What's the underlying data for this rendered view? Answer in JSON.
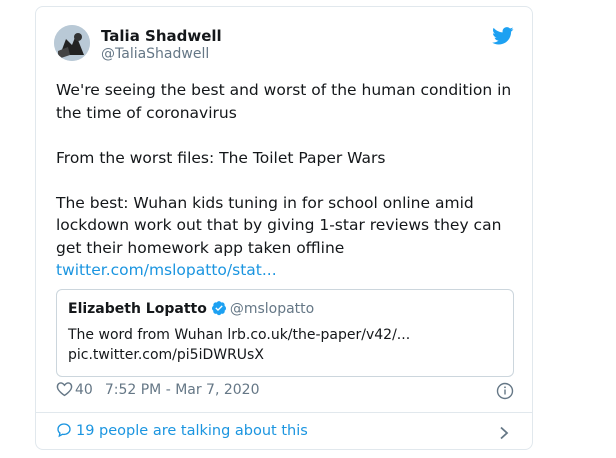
{
  "author": {
    "name": "Talia Shadwell",
    "handle": "@TaliaShadwell"
  },
  "tweet": {
    "paragraphs": [
      "We're seeing the best and worst of the human condition in the time of coronavirus",
      "From the worst files: The Toilet Paper Wars",
      "The best: Wuhan kids tuning in for school online amid lockdown work out that by giving 1-star reviews they can get their homework app taken offline"
    ],
    "link": "twitter.com/mslopatto/stat..."
  },
  "quote": {
    "name": "Elizabeth Lopatto",
    "handle": "@mslopatto",
    "line1": "The word from Wuhan  lrb.co.uk/the-paper/v42/...",
    "line2": "pic.twitter.com/pi5iDWRUsX"
  },
  "meta": {
    "likes": "40",
    "timestamp": "7:52 PM - Mar 7, 2020"
  },
  "footer": {
    "talking": "19 people are talking about this"
  },
  "colors": {
    "link": "#1b95e0",
    "secondary_text": "#657786",
    "border": "#e1e8ed"
  },
  "icons": [
    "avatar",
    "twitter-bird-icon",
    "verified-badge-icon",
    "heart-icon",
    "info-icon",
    "speech-bubble-icon",
    "chevron-right-icon"
  ]
}
